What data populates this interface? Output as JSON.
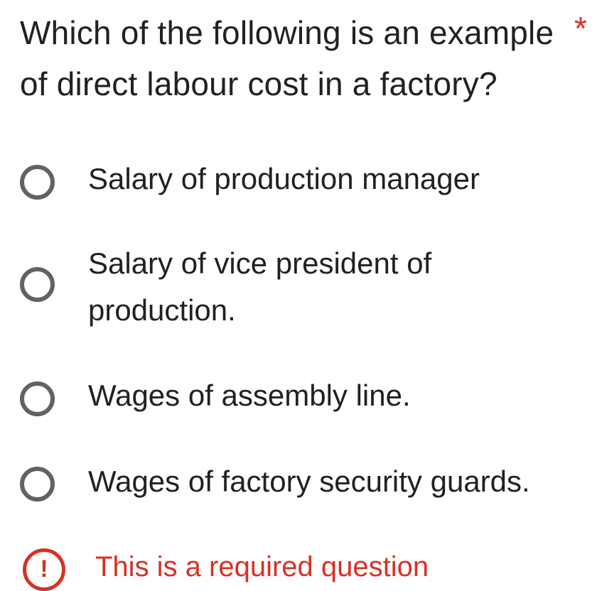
{
  "question": {
    "title": "Which of the following is an example of direct labour cost in a factory?",
    "required_marker": "*"
  },
  "options": [
    {
      "label": "Salary of production manager",
      "selected": false
    },
    {
      "label": "Salary of vice president of production.",
      "selected": false
    },
    {
      "label": "Wages of assembly line.",
      "selected": false
    },
    {
      "label": "Wages of factory security guards.",
      "selected": false
    }
  ],
  "validation": {
    "icon": "error-exclamation-icon",
    "icon_glyph": "!",
    "message": "This is a required question"
  },
  "colors": {
    "text": "#202124",
    "radio_border": "#5f6368",
    "error": "#d93025"
  }
}
